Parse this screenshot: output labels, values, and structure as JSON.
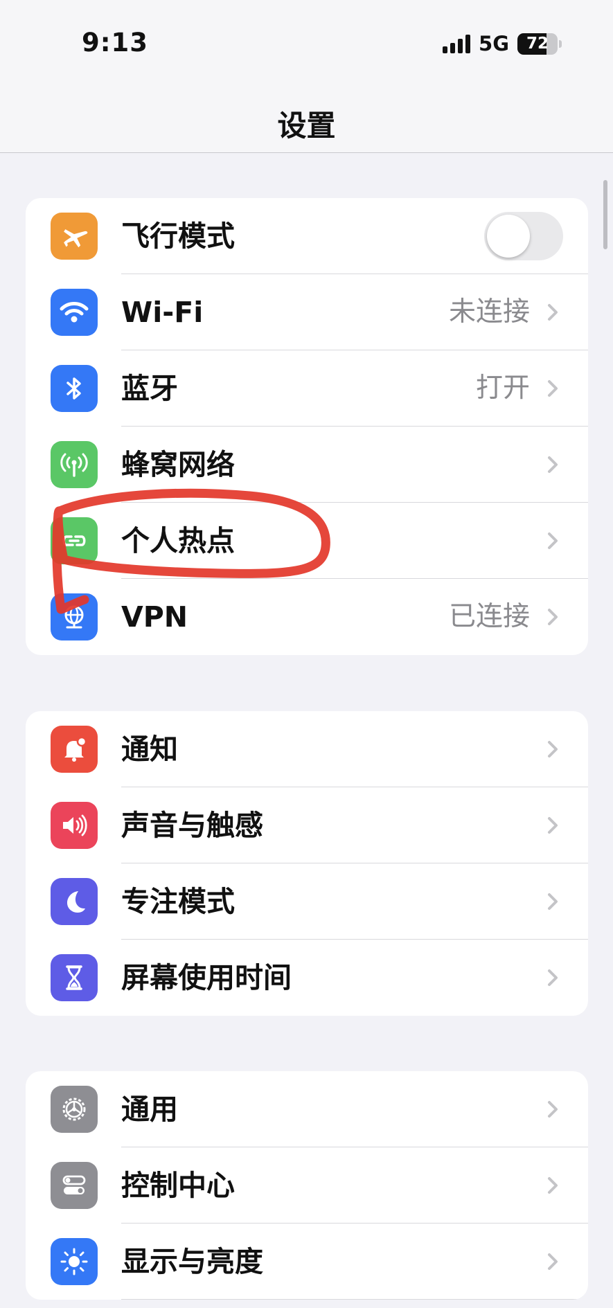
{
  "status_bar": {
    "time": "9:13",
    "network": "5G",
    "battery": "72",
    "battery_fraction": 0.72
  },
  "nav": {
    "title": "设置"
  },
  "groups": [
    {
      "rows": [
        {
          "label": "飞行模式",
          "icon": "airplane-icon",
          "color": "#f09a37",
          "toggle": false
        },
        {
          "label": "Wi-Fi",
          "icon": "wifi-icon",
          "color": "#3478f6",
          "value": "未连接"
        },
        {
          "label": "蓝牙",
          "icon": "bluetooth-icon",
          "color": "#3478f6",
          "value": "打开"
        },
        {
          "label": "蜂窝网络",
          "icon": "cellular-icon",
          "color": "#5ac766"
        },
        {
          "label": "个人热点",
          "icon": "hotspot-icon",
          "color": "#5ac766"
        },
        {
          "label": "VPN",
          "icon": "vpn-globe-icon",
          "color": "#3478f6",
          "value": "已连接"
        }
      ]
    },
    {
      "rows": [
        {
          "label": "通知",
          "icon": "bell-icon",
          "color": "#eb4d3d"
        },
        {
          "label": "声音与触感",
          "icon": "speaker-icon",
          "color": "#eb445a"
        },
        {
          "label": "专注模式",
          "icon": "moon-icon",
          "color": "#5e5ce6"
        },
        {
          "label": "屏幕使用时间",
          "icon": "hourglass-icon",
          "color": "#5e5ce6"
        }
      ]
    },
    {
      "rows": [
        {
          "label": "通用",
          "icon": "gear-icon",
          "color": "#8e8e93"
        },
        {
          "label": "控制中心",
          "icon": "toggles-icon",
          "color": "#8e8e93"
        },
        {
          "label": "显示与亮度",
          "icon": "sun-icon",
          "color": "#3478f6"
        }
      ]
    }
  ],
  "annotation": {
    "color": "#e3372a",
    "target": "个人热点"
  }
}
